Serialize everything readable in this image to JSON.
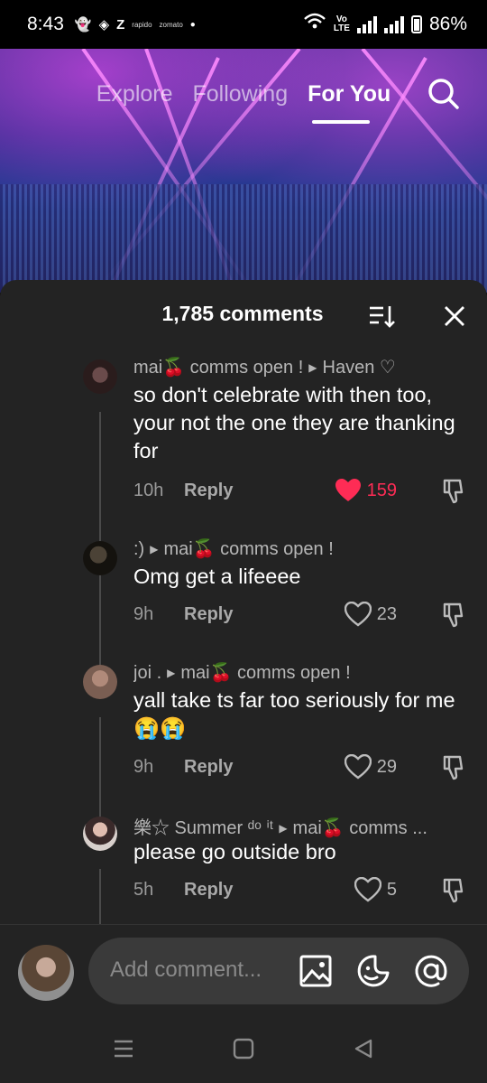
{
  "status": {
    "time": "8:43",
    "notif_z": "Z",
    "notif_small_1": "rapido",
    "notif_small_2": "zomato",
    "volte_top": "Vo",
    "volte_bottom": "LTE",
    "battery": "86%"
  },
  "nav": {
    "tabs": [
      {
        "label": "Explore"
      },
      {
        "label": "Following"
      },
      {
        "label": "For You"
      }
    ],
    "active_tab": "For You"
  },
  "comments_panel": {
    "count_label": "1,785 comments",
    "comments": [
      {
        "author": "mai🍒 comms open !",
        "reply_to": "Haven ♡",
        "text": "so don't celebrate with then too, your not the one they are thanking for",
        "time": "10h",
        "reply_label": "Reply",
        "likes": "159",
        "liked": true
      },
      {
        "author": ":)",
        "reply_to": "mai🍒 comms open !",
        "text": "Omg get a lifeeee",
        "time": "9h",
        "reply_label": "Reply",
        "likes": "23",
        "liked": false
      },
      {
        "author": "joi .",
        "reply_to": "mai🍒 comms open !",
        "text": "yall take ts far too seriously for me😭😭",
        "time": "9h",
        "reply_label": "Reply",
        "likes": "29",
        "liked": false
      },
      {
        "author": "樂☆ Summer ᵈᵒ ⁱᵗ",
        "reply_to": "mai🍒 comms ...",
        "text": "please go outside bro",
        "time": "5h",
        "reply_label": "Reply",
        "likes": "5",
        "liked": false
      }
    ]
  },
  "composer": {
    "placeholder": "Add comment..."
  },
  "icons": {
    "search": "search-icon",
    "sort": "sort-icon",
    "close": "close-icon",
    "heart": "heart-icon",
    "dislike": "dislike-icon",
    "image": "image-icon",
    "emoji": "sticker-icon",
    "mention": "at-icon"
  },
  "colors": {
    "accent_red": "#fe2c55",
    "sheet_bg": "#232323"
  }
}
